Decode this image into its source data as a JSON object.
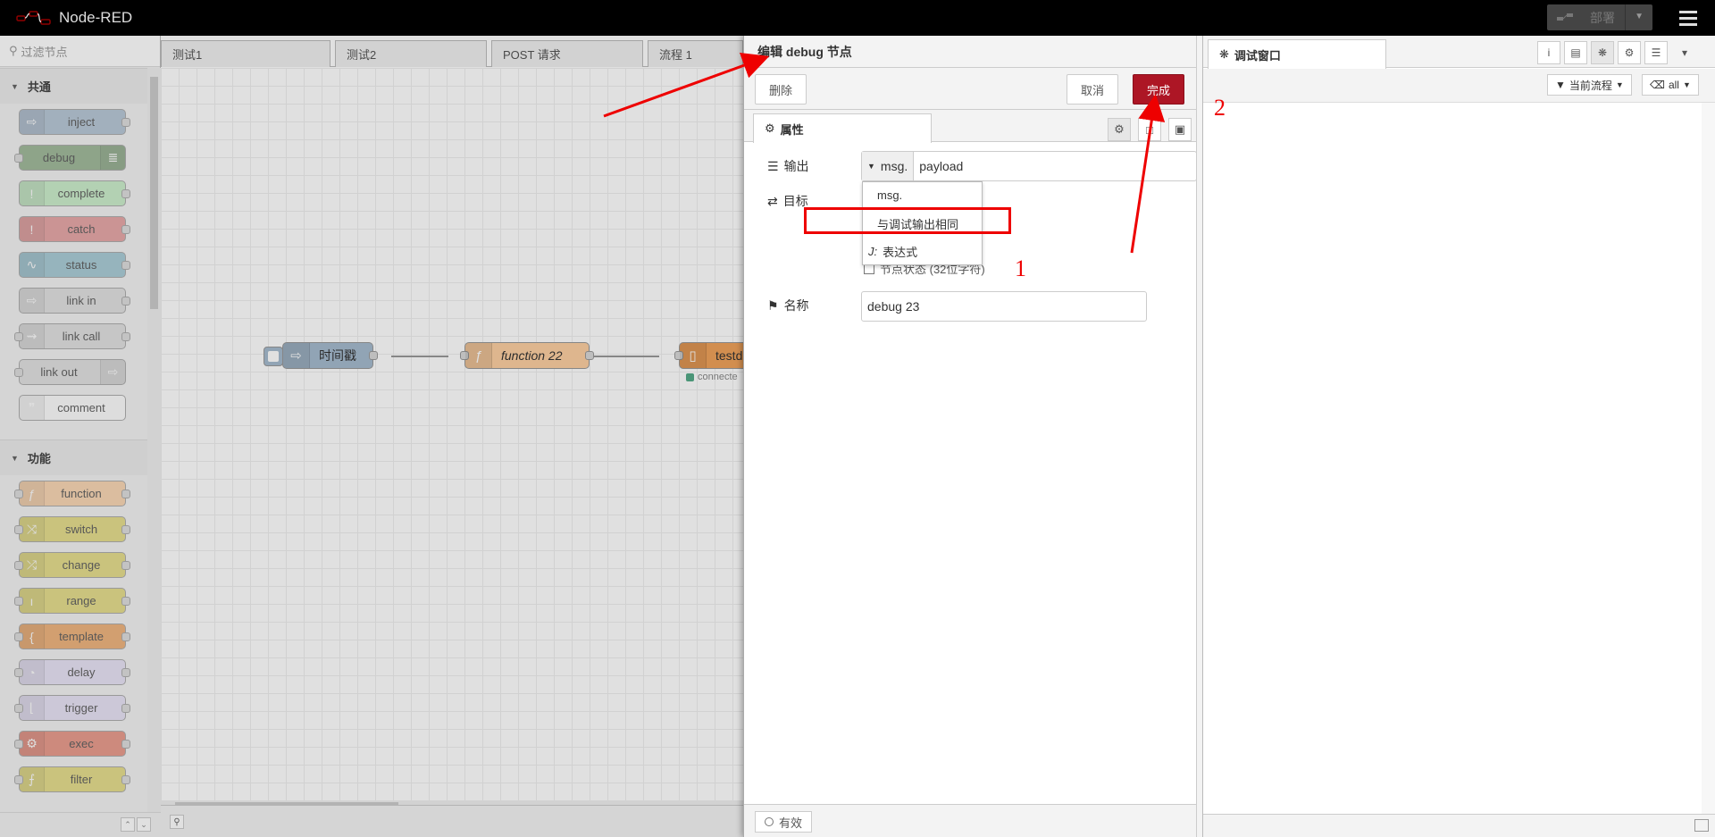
{
  "header": {
    "app_name": "Node-RED",
    "deploy_label": "部署"
  },
  "palette": {
    "search_placeholder": "过滤节点",
    "categories": [
      {
        "label": "共通",
        "nodes": [
          {
            "label": "inject",
            "color": "#a6bbcf",
            "icon": "arrow-right-icon",
            "side": "left"
          },
          {
            "label": "debug",
            "color": "#87a980",
            "icon": "list-icon",
            "side": "right"
          },
          {
            "label": "complete",
            "color": "#c0edc0",
            "icon": "exclamation-icon",
            "side": "left"
          },
          {
            "label": "catch",
            "color": "#e49191",
            "icon": "exclamation-icon",
            "side": "left"
          },
          {
            "label": "status",
            "color": "#94c1d0",
            "icon": "pulse-icon",
            "side": "left"
          },
          {
            "label": "link in",
            "color": "#dddddd",
            "icon": "arrow-right-icon",
            "side": "left"
          },
          {
            "label": "link call",
            "color": "#dddddd",
            "icon": "link-icon",
            "side": "left"
          },
          {
            "label": "link out",
            "color": "#dddddd",
            "icon": "arrow-right-icon",
            "side": "right"
          },
          {
            "label": "comment",
            "color": "#ffffff",
            "icon": "comment-icon",
            "side": "left"
          }
        ]
      },
      {
        "label": "功能",
        "nodes": [
          {
            "label": "function",
            "color": "#fdd0a2",
            "icon": "function-icon",
            "side": "left"
          },
          {
            "label": "switch",
            "color": "#e2d96e",
            "icon": "switch-icon",
            "side": "left"
          },
          {
            "label": "change",
            "color": "#e2d96e",
            "icon": "shuffle-icon",
            "side": "left"
          },
          {
            "label": "range",
            "color": "#e2d96e",
            "icon": "range-icon",
            "side": "left"
          },
          {
            "label": "template",
            "color": "#f0a25a",
            "icon": "brace-icon",
            "side": "left"
          },
          {
            "label": "delay",
            "color": "#e6e0f8",
            "icon": "clock-icon",
            "side": "left"
          },
          {
            "label": "trigger",
            "color": "#e6e0f8",
            "icon": "trigger-icon",
            "side": "left"
          },
          {
            "label": "exec",
            "color": "#e8826e",
            "icon": "gear-icon",
            "side": "left"
          },
          {
            "label": "filter",
            "color": "#e2d96e",
            "icon": "filter-icon",
            "side": "left"
          }
        ]
      }
    ]
  },
  "workspace": {
    "tabs": [
      "测试1",
      "测试2",
      "POST 请求",
      "流程 1"
    ],
    "nodes": [
      {
        "label": "时间戳",
        "color": "#a6bbcf"
      },
      {
        "label": "function 22",
        "color": "#fdd0a2"
      },
      {
        "label": "testd",
        "color": "#f0a25a",
        "status": "connecte"
      }
    ]
  },
  "tray": {
    "title": "编辑 debug 节点",
    "delete_label": "删除",
    "cancel_label": "取消",
    "done_label": "完成",
    "properties_tab": "属性",
    "output_label": "输出",
    "output_prefix": "msg.",
    "output_value": "payload",
    "target_label": "目标",
    "node_status_label": "节点状态 (32位字符)",
    "name_label": "名称",
    "name_value": "debug 23",
    "valid_label": "有效"
  },
  "dropdown": {
    "options": [
      "msg.",
      "与调试输出相同",
      "表达式"
    ]
  },
  "sidebar": {
    "tab_label": "调试窗口",
    "filter_label": "当前流程",
    "clear_label": "all"
  },
  "annotations": {
    "label_1": "1",
    "label_2": "2"
  },
  "colors": {
    "primary": "#ad1625",
    "header": "#000000",
    "annotation": "#ee0000"
  }
}
